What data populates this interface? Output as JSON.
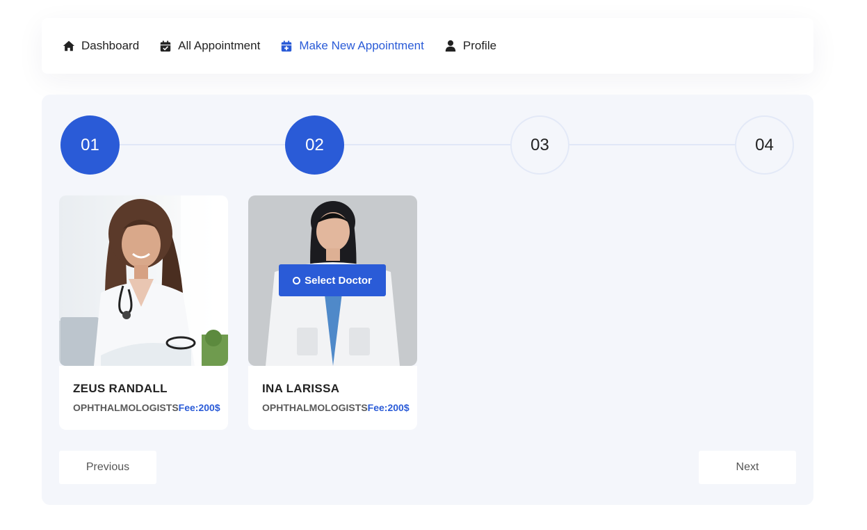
{
  "nav": {
    "items": [
      {
        "label": "Dashboard",
        "icon": "home-icon"
      },
      {
        "label": "All Appointment",
        "icon": "calendar-check-icon"
      },
      {
        "label": "Make New Appointment",
        "icon": "calendar-plus-icon",
        "active": true
      },
      {
        "label": "Profile",
        "icon": "user-icon"
      }
    ]
  },
  "steps": [
    {
      "label": "01",
      "state": "done"
    },
    {
      "label": "02",
      "state": "done"
    },
    {
      "label": "03",
      "state": "todo"
    },
    {
      "label": "04",
      "state": "todo"
    }
  ],
  "doctors": [
    {
      "name": "ZEUS RANDALL",
      "specialty": "OPHTHALMOLOGISTS",
      "fee": "Fee:200$"
    },
    {
      "name": "INA LARISSA",
      "specialty": "OPHTHALMOLOGISTS",
      "fee": "Fee:200$",
      "select_label": "Select Doctor"
    }
  ],
  "buttons": {
    "previous": "Previous",
    "next": "Next"
  },
  "colors": {
    "accent": "#2a5bd7",
    "panel": "#f4f6fb",
    "text": "#222222"
  }
}
